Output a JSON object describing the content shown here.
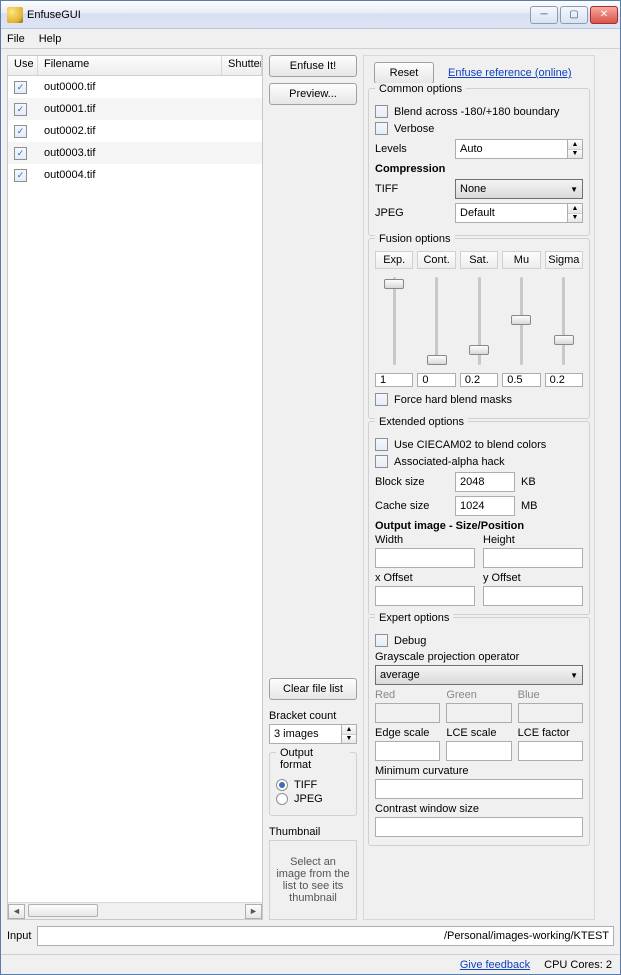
{
  "window": {
    "title": "EnfuseGUI"
  },
  "menu": {
    "file": "File",
    "help": "Help"
  },
  "columns": {
    "use": "Use",
    "filename": "Filename",
    "shutter": "Shutter"
  },
  "files": [
    {
      "use": true,
      "name": "out0000.tif"
    },
    {
      "use": true,
      "name": "out0001.tif"
    },
    {
      "use": true,
      "name": "out0002.tif"
    },
    {
      "use": true,
      "name": "out0003.tif"
    },
    {
      "use": true,
      "name": "out0004.tif"
    }
  ],
  "mid": {
    "enfuse": "Enfuse It!",
    "preview": "Preview...",
    "clear": "Clear file list",
    "bracket_label": "Bracket count",
    "bracket_value": "3 images",
    "output_format_label": "Output format",
    "tiff": "TIFF",
    "jpeg": "JPEG",
    "thumbnail_label": "Thumbnail",
    "thumbnail_hint": "Select an image from the list to see its thumbnail"
  },
  "right": {
    "reset": "Reset",
    "ref_link": "Enfuse reference (online)",
    "common_legend": "Common options",
    "blend_across": "Blend across -180/+180 boundary",
    "verbose": "Verbose",
    "levels_lab": "Levels",
    "levels_val": "Auto",
    "compression": "Compression",
    "tiff_lab": "TIFF",
    "tiff_val": "None",
    "jpeg_lab": "JPEG",
    "jpeg_val": "Default",
    "fusion_legend": "Fusion options",
    "fusion_headers": {
      "exp": "Exp.",
      "cont": "Cont.",
      "sat": "Sat.",
      "mu": "Mu",
      "sigma": "Sigma"
    },
    "fusion_values": {
      "exp": "1",
      "cont": "0",
      "sat": "0.2",
      "mu": "0.5",
      "sigma": "0.2"
    },
    "fusion_slider_pos": {
      "exp": 4,
      "cont": 80,
      "sat": 70,
      "mu": 40,
      "sigma": 60
    },
    "force_hard": "Force hard blend masks",
    "extended_legend": "Extended options",
    "use_ciecam": "Use CIECAM02 to blend colors",
    "assoc_alpha": "Associated-alpha hack",
    "block_size_lab": "Block size",
    "block_size_val": "2048",
    "kb": "KB",
    "cache_size_lab": "Cache size",
    "cache_size_val": "1024",
    "mb": "MB",
    "out_image": "Output image - Size/Position",
    "width_lab": "Width",
    "height_lab": "Height",
    "xoff_lab": "x Offset",
    "yoff_lab": "y Offset",
    "expert_legend": "Expert options",
    "debug": "Debug",
    "gray_proj": "Grayscale projection operator",
    "gray_proj_val": "average",
    "red": "Red",
    "green": "Green",
    "blue": "Blue",
    "edge_scale": "Edge scale",
    "lce_scale": "LCE scale",
    "lce_factor": "LCE factor",
    "min_curv": "Minimum curvature",
    "contrast_win": "Contrast window size"
  },
  "input": {
    "label": "Input",
    "value": "/Personal/images-working/KTEST"
  },
  "status": {
    "feedback": "Give feedback",
    "cores": "CPU Cores: 2"
  }
}
